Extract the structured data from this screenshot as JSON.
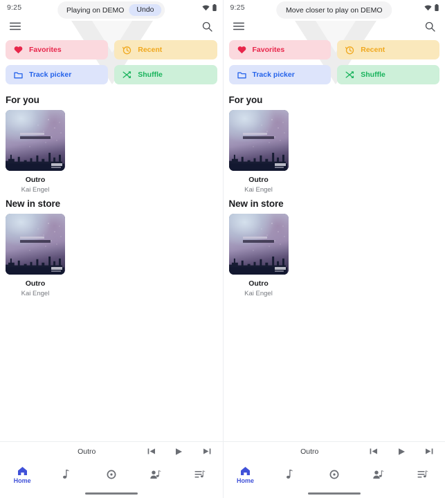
{
  "app": {
    "accent_color": "#4051d8",
    "background_color": "#ffffff"
  },
  "panels": [
    {
      "id": "left",
      "status_bar": {
        "time": "9:25",
        "icons": [
          "wifi-icon",
          "battery-icon"
        ]
      },
      "app_bar": {
        "menu_icon": "hamburger-menu-icon",
        "search_icon": "search-icon"
      },
      "snackbar": {
        "message": "Playing on DEMO",
        "action_label": "Undo",
        "has_action": true
      },
      "chips": [
        {
          "label": "Favorites",
          "icon": "heart-icon",
          "bg": "#fbd9de",
          "fg": "#e8264b"
        },
        {
          "label": "Recent",
          "icon": "clock-icon",
          "bg": "#fae8bc",
          "fg": "#f0a81e"
        },
        {
          "label": "Track picker",
          "icon": "folder-icon",
          "bg": "#dde4fb",
          "fg": "#2563ea"
        },
        {
          "label": "Shuffle",
          "icon": "shuffle-icon",
          "bg": "#cdf0d9",
          "fg": "#19b35c"
        }
      ],
      "sections": [
        {
          "title": "For you",
          "cards": [
            {
              "title": "Outro",
              "artist": "Kai Engel"
            }
          ]
        },
        {
          "title": "New in store",
          "cards": [
            {
              "title": "Outro",
              "artist": "Kai Engel"
            }
          ]
        }
      ],
      "mini_player": {
        "track_title": "Outro",
        "controls": [
          "skip-previous-icon",
          "play-icon",
          "skip-next-icon"
        ]
      },
      "bottom_nav": [
        {
          "label": "Home",
          "icon": "home-icon",
          "selected": true
        },
        {
          "label": "",
          "icon": "music-note-icon",
          "selected": false
        },
        {
          "label": "",
          "icon": "album-disc-icon",
          "selected": false
        },
        {
          "label": "",
          "icon": "artist-icon",
          "selected": false
        },
        {
          "label": "",
          "icon": "playlist-icon",
          "selected": false
        }
      ]
    },
    {
      "id": "right",
      "status_bar": {
        "time": "9:25",
        "icons": [
          "wifi-icon",
          "battery-icon"
        ]
      },
      "app_bar": {
        "menu_icon": "hamburger-menu-icon",
        "search_icon": "search-icon"
      },
      "snackbar": {
        "message": "Move closer to play on DEMO",
        "action_label": "",
        "has_action": false
      },
      "chips": [
        {
          "label": "Favorites",
          "icon": "heart-icon",
          "bg": "#fbd9de",
          "fg": "#e8264b"
        },
        {
          "label": "Recent",
          "icon": "clock-icon",
          "bg": "#fae8bc",
          "fg": "#f0a81e"
        },
        {
          "label": "Track picker",
          "icon": "folder-icon",
          "bg": "#dde4fb",
          "fg": "#2563ea"
        },
        {
          "label": "Shuffle",
          "icon": "shuffle-icon",
          "bg": "#cdf0d9",
          "fg": "#19b35c"
        }
      ],
      "sections": [
        {
          "title": "For you",
          "cards": [
            {
              "title": "Outro",
              "artist": "Kai Engel"
            }
          ]
        },
        {
          "title": "New in store",
          "cards": [
            {
              "title": "Outro",
              "artist": "Kai Engel"
            }
          ]
        }
      ],
      "mini_player": {
        "track_title": "Outro",
        "controls": [
          "skip-previous-icon",
          "play-icon",
          "skip-next-icon"
        ]
      },
      "bottom_nav": [
        {
          "label": "Home",
          "icon": "home-icon",
          "selected": true
        },
        {
          "label": "",
          "icon": "music-note-icon",
          "selected": false
        },
        {
          "label": "",
          "icon": "album-disc-icon",
          "selected": false
        },
        {
          "label": "",
          "icon": "artist-icon",
          "selected": false
        },
        {
          "label": "",
          "icon": "playlist-icon",
          "selected": false
        }
      ]
    }
  ]
}
